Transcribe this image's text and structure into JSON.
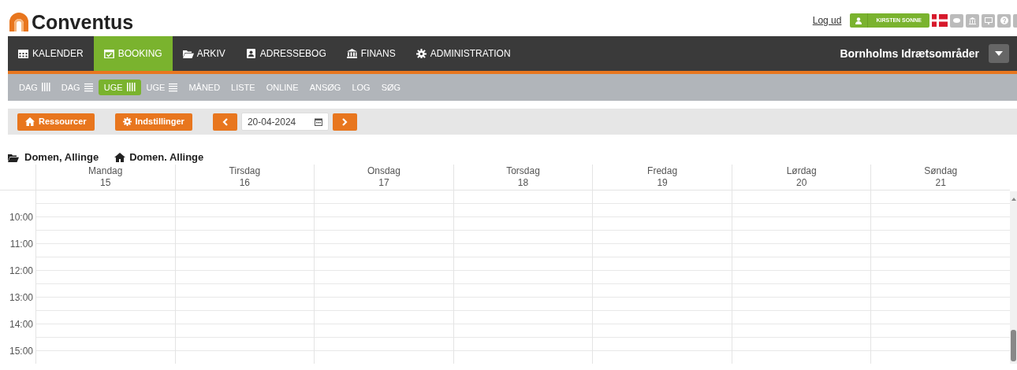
{
  "logo": {
    "text": "Conventus"
  },
  "top_links": {
    "logout": "Log ud",
    "user": "KIRSTEN SONNE"
  },
  "main_nav": [
    {
      "label": "KALENDER",
      "kind": "calendar",
      "selected": false
    },
    {
      "label": "BOOKING",
      "kind": "check",
      "selected": true
    },
    {
      "label": "ARKIV",
      "kind": "folder",
      "selected": false
    },
    {
      "label": "ADRESSEBOG",
      "kind": "contact",
      "selected": false
    },
    {
      "label": "FINANS",
      "kind": "bank",
      "selected": false
    },
    {
      "label": "ADMINISTRATION",
      "kind": "gear",
      "selected": false
    }
  ],
  "organization": "Bornholms Idrætsområder",
  "sub_nav": [
    {
      "label": "DAG",
      "kind": "columns",
      "selected": false
    },
    {
      "label": "DAG",
      "kind": "rows",
      "selected": false
    },
    {
      "label": "UGE",
      "kind": "columns",
      "selected": true
    },
    {
      "label": "UGE",
      "kind": "rows",
      "selected": false
    },
    {
      "label": "MÅNED",
      "selected": false
    },
    {
      "label": "LISTE",
      "selected": false
    },
    {
      "label": "ONLINE",
      "selected": false
    },
    {
      "label": "ANSØG",
      "selected": false
    },
    {
      "label": "LOG",
      "selected": false
    },
    {
      "label": "SØG",
      "selected": false
    }
  ],
  "toolbar": {
    "resources": "Ressourcer",
    "settings": "Indstillinger",
    "date": "20-04-2024"
  },
  "breadcrumb": [
    {
      "kind": "folder",
      "label": "Domen, Allinge"
    },
    {
      "kind": "home",
      "label": "Domen. Allinge"
    }
  ],
  "days": [
    {
      "name": "Mandag",
      "date": "15"
    },
    {
      "name": "Tirsdag",
      "date": "16"
    },
    {
      "name": "Onsdag",
      "date": "17"
    },
    {
      "name": "Torsdag",
      "date": "18"
    },
    {
      "name": "Fredag",
      "date": "19"
    },
    {
      "name": "Lørdag",
      "date": "20"
    },
    {
      "name": "Søndag",
      "date": "21"
    }
  ],
  "hours": [
    "10:00",
    "11:00",
    "12:00",
    "13:00",
    "14:00",
    "15:00"
  ]
}
